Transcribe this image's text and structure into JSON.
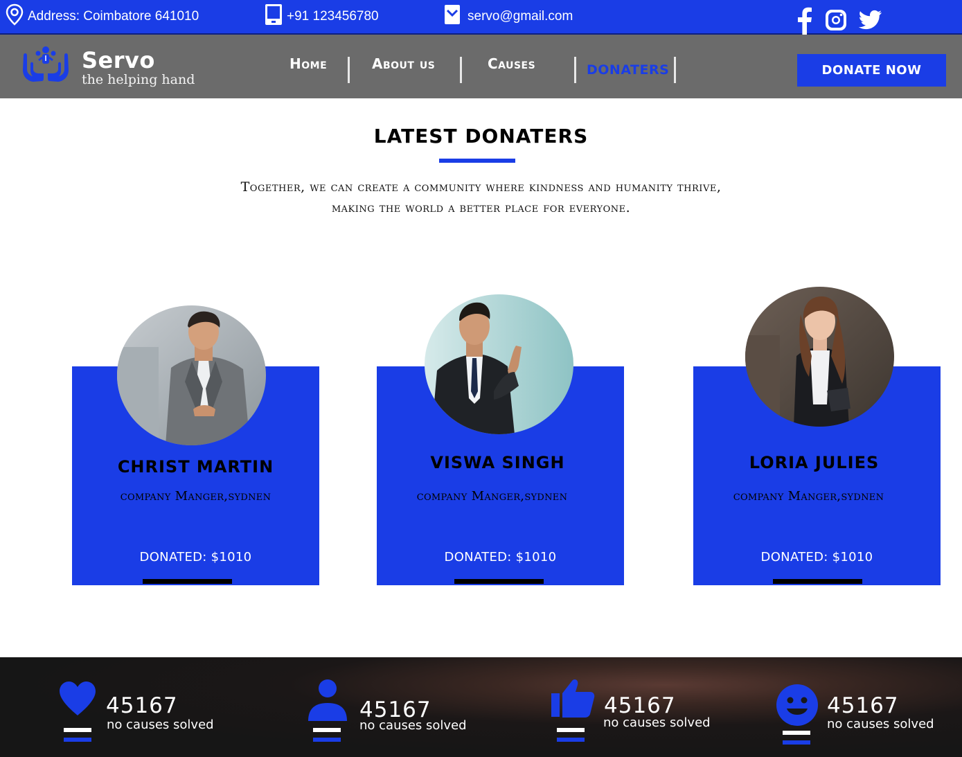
{
  "topbar": {
    "address": "Address: Coimbatore 641010",
    "phone": "+91 123456780",
    "email": "servo@gmail.com",
    "social_icons": [
      "facebook-icon",
      "instagram-icon",
      "twitter-icon"
    ]
  },
  "brand": {
    "name": "Servo",
    "tagline": "the helping hand"
  },
  "nav": {
    "items": [
      {
        "label": "Home",
        "active": false
      },
      {
        "label": "About us",
        "active": false
      },
      {
        "label": "Causes",
        "active": false
      },
      {
        "label": "DONATERS",
        "active": true
      }
    ],
    "donate_label": "DONATE NOW"
  },
  "section": {
    "title": "LATEST DONATERS",
    "subtitle_line1": "Together, we can create a community where kindness and humanity thrive,",
    "subtitle_line2": "making the world a better place for everyone."
  },
  "donors": [
    {
      "name": "CHRIST MARTIN",
      "role": "company Manger,sydnen",
      "donated": "DONATED: $1010"
    },
    {
      "name": "VISWA SINGH",
      "role": "company Manger,sydnen",
      "donated": "DONATED: $1010"
    },
    {
      "name": "LORIA JULIES",
      "role": "company Manger,sydnen",
      "donated": "DONATED: $1010"
    }
  ],
  "stats": [
    {
      "icon": "heart-icon",
      "value": "45167",
      "label": "no causes solved"
    },
    {
      "icon": "person-icon",
      "value": "45167",
      "label": "no causes solved"
    },
    {
      "icon": "thumbs-up-icon",
      "value": "45167",
      "label": "no causes solved"
    },
    {
      "icon": "smiley-icon",
      "value": "45167",
      "label": "no causes solved"
    }
  ],
  "colors": {
    "accent": "#1a3de6",
    "nav_bg": "#6b6b6b",
    "stats_bg": "#181818"
  }
}
